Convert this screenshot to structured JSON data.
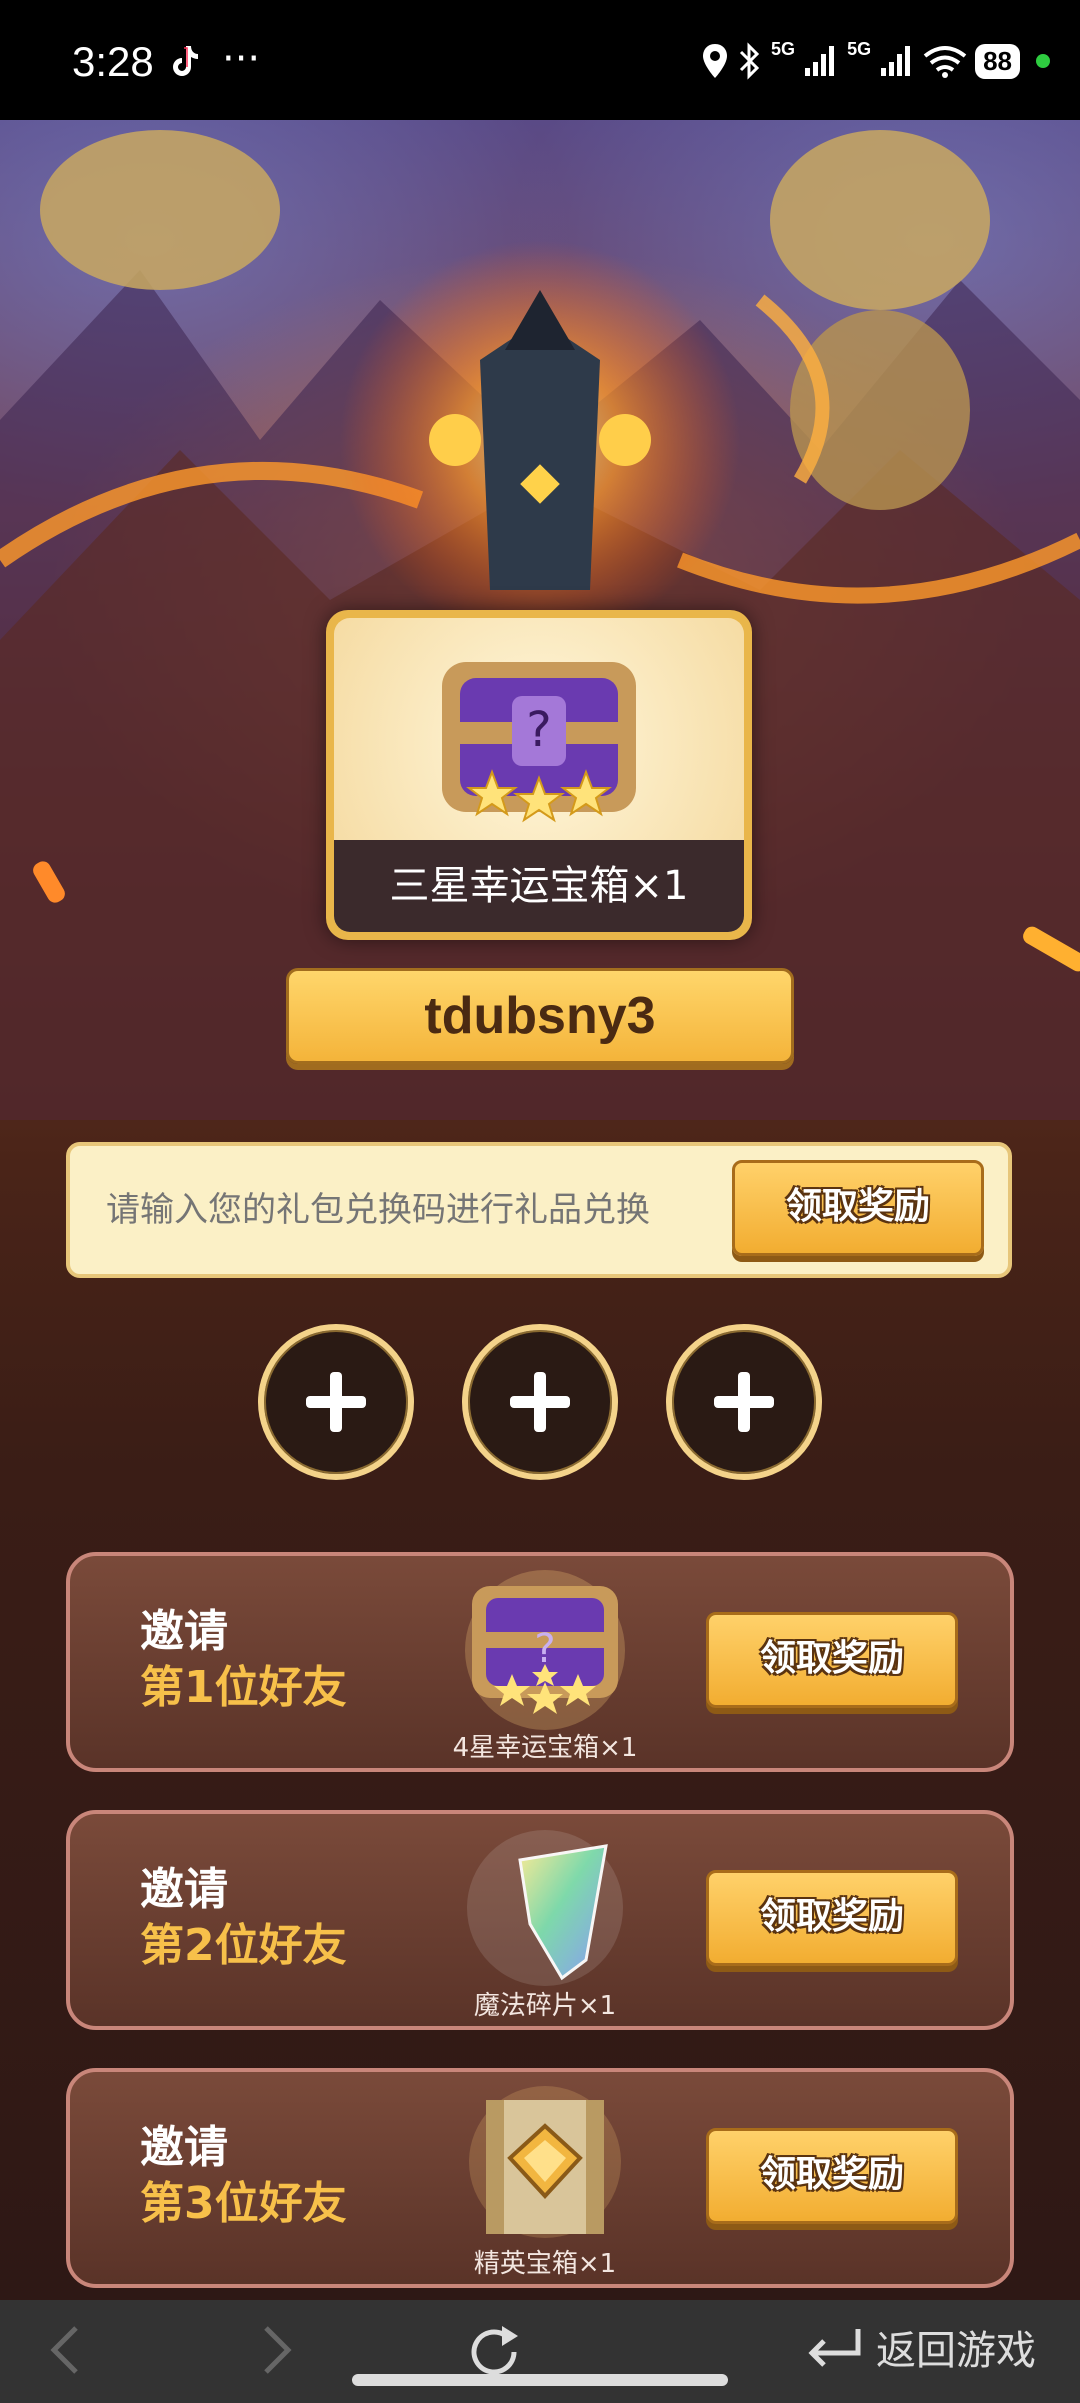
{
  "status_bar": {
    "time": "3:28",
    "battery": "88",
    "network_1": "5G",
    "network_2": "5G"
  },
  "reward": {
    "caption": "三星幸运宝箱×1"
  },
  "user": {
    "name": "tdubsny3"
  },
  "redeem": {
    "placeholder": "请输入您的礼包兑换码进行礼品兑换",
    "button": "领取奖励"
  },
  "invite_cards": [
    {
      "line1": "邀请",
      "line2": "第1位好友",
      "item": "4星幸运宝箱×1",
      "button": "领取奖励"
    },
    {
      "line1": "邀请",
      "line2": "第2位好友",
      "item": "魔法碎片×1",
      "button": "领取奖励"
    },
    {
      "line1": "邀请",
      "line2": "第3位好友",
      "item": "精英宝箱×1",
      "button": "领取奖励"
    }
  ],
  "navbar": {
    "return_label": "返回游戏"
  },
  "colors": {
    "accent_gold": "#f4b43a",
    "highlight_text": "#f7c04a",
    "card_bg": "#6a3d30"
  }
}
